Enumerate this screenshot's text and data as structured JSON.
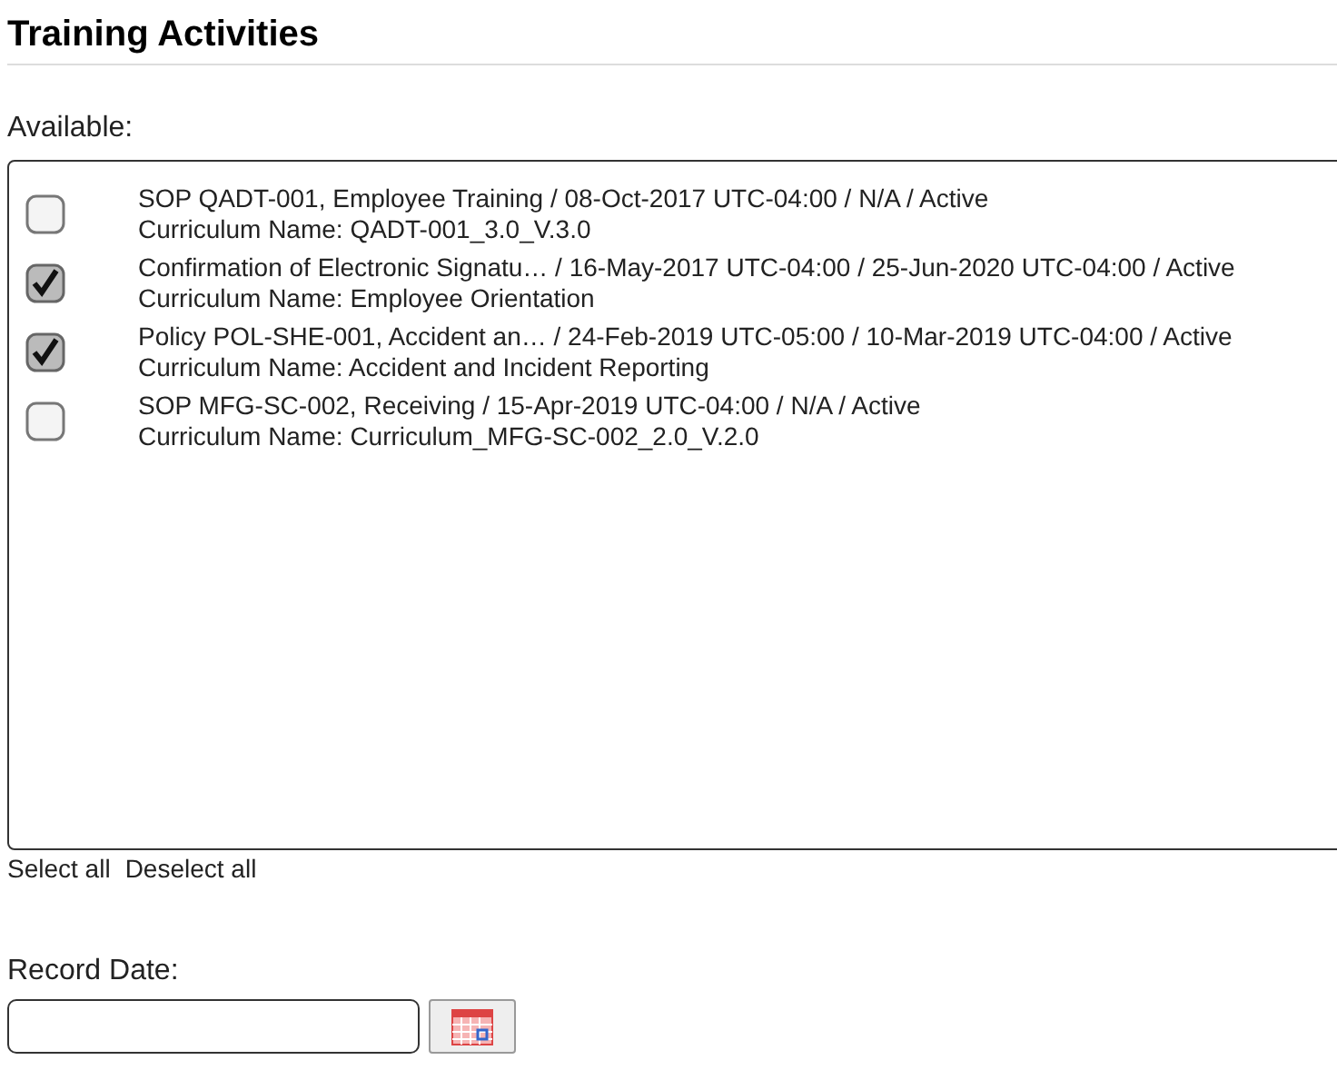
{
  "title": "Training Activities",
  "available": {
    "label": "Available:",
    "items": [
      {
        "line1": "SOP QADT-001, Employee Training / 08-Oct-2017 UTC-04:00 / N/A / Active",
        "line2": "Curriculum Name: QADT-001_3.0_V.3.0",
        "checked": false
      },
      {
        "line1": "Confirmation of Electronic Signatu…  / 16-May-2017 UTC-04:00 / 25-Jun-2020 UTC-04:00 / Active",
        "line2": "Curriculum Name: Employee Orientation",
        "checked": true
      },
      {
        "line1": "Policy POL-SHE-001, Accident an…  / 24-Feb-2019 UTC-05:00 / 10-Mar-2019 UTC-04:00 / Active",
        "line2": "Curriculum Name: Accident and Incident Reporting",
        "checked": true
      },
      {
        "line1": "SOP MFG-SC-002, Receiving / 15-Apr-2019 UTC-04:00 / N/A / Active",
        "line2": "Curriculum Name: Curriculum_MFG-SC-002_2.0_V.2.0",
        "checked": false
      }
    ]
  },
  "links": [
    "Select all",
    "Deselect all"
  ],
  "record_date": {
    "label": "Record Date:"
  }
}
